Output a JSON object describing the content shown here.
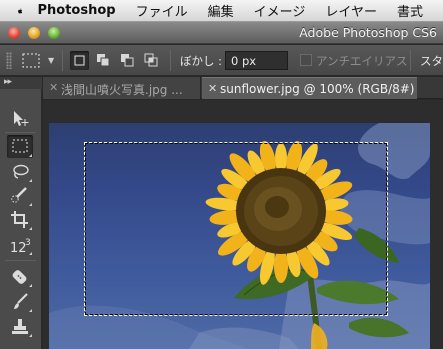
{
  "menubar": {
    "app_name": "Photoshop",
    "items": [
      "ファイル",
      "編集",
      "イメージ",
      "レイヤー",
      "書式"
    ]
  },
  "window": {
    "title": "Adobe Photoshop CS6"
  },
  "options_bar": {
    "feather_label": "ぼかし :",
    "feather_value": "0 px",
    "antialias_label": "アンチエイリアス",
    "antialias_checked": false,
    "style_label": "スタ"
  },
  "tabs": [
    {
      "label": "浅間山噴火写真.jpg ...",
      "active": false
    },
    {
      "label": "sunflower.jpg @ 100% (RGB/8#)",
      "active": true
    }
  ],
  "tools": [
    {
      "name": "move-tool-icon"
    },
    {
      "name": "rectangular-marquee-tool-icon",
      "active": true
    },
    {
      "name": "lasso-tool-icon"
    },
    {
      "name": "quick-selection-tool-icon"
    },
    {
      "name": "crop-tool-icon"
    },
    {
      "name": "eyedropper-tool-icon",
      "label": "123"
    },
    {
      "name": "spot-healing-brush-tool-icon"
    },
    {
      "name": "brush-tool-icon"
    },
    {
      "name": "clone-stamp-tool-icon"
    }
  ],
  "colors": {
    "ui_dark": "#4b4b4b",
    "sky": "#3f5a9c",
    "petal": "#f2b21a",
    "seed_head": "#4a3511"
  }
}
